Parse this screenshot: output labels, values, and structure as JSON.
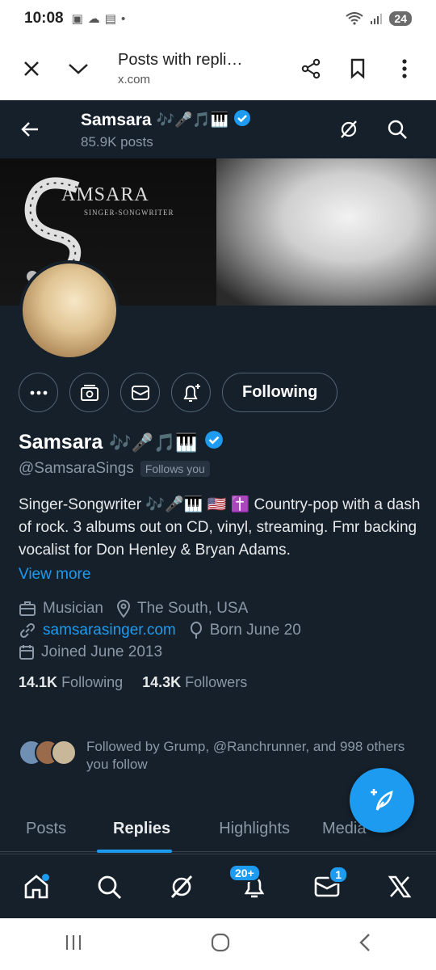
{
  "status_bar": {
    "time": "10:08",
    "battery": "24"
  },
  "browser": {
    "page_title": "Posts with repli…",
    "domain": "x.com"
  },
  "header": {
    "name": "Samsara",
    "name_emojis": "🎶🎤🎵🎹",
    "posts_count": "85.9K posts"
  },
  "banner": {
    "logo_text": "AMSARA",
    "logo_sub": "SINGER-SONGWRITER"
  },
  "actions": {
    "following_label": "Following"
  },
  "profile": {
    "name": "Samsara",
    "name_emojis": "🎶🎤🎵🎹",
    "handle": "@SamsaraSings",
    "follows_you": "Follows you",
    "bio": "Singer-Songwriter 🎶🎤🎹 🇺🇸 ✝️ Country-pop with a dash of rock. 3 albums out on CD, vinyl, streaming. Fmr backing vocalist for Don Henley & Bryan Adams.",
    "view_more": "View more",
    "category": "Musician",
    "location": "The South, USA",
    "website": "samsarasinger.com",
    "birthday": "Born June 20",
    "joined": "Joined June 2013",
    "following_count": "14.1K",
    "following_label": "Following",
    "followers_count": "14.3K",
    "followers_label": "Followers",
    "followed_by": "Followed by Grump, @Ranchrunner, and 998 others you follow"
  },
  "tabs": [
    {
      "label": "Posts"
    },
    {
      "label": "Replies"
    },
    {
      "label": "Highlights"
    },
    {
      "label": "Media"
    }
  ],
  "bottom_nav": {
    "notifications_badge": "20+",
    "messages_badge": "1"
  },
  "colors": {
    "background": "#15202b",
    "accent": "#1d9bf0",
    "muted": "#8b98a5",
    "border": "#536471"
  }
}
